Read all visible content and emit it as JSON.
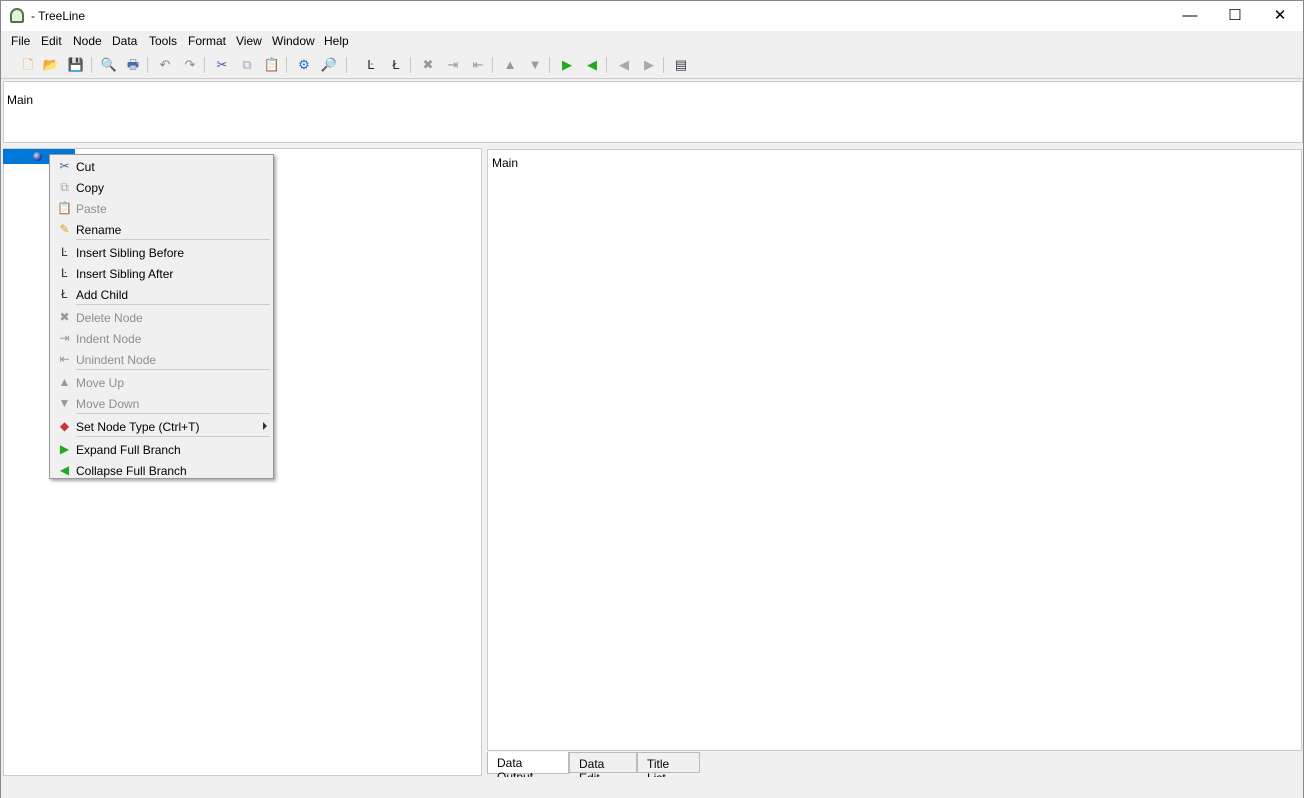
{
  "window": {
    "title": "- TreeLine",
    "minimize": "—",
    "maximize": "☐",
    "close": "✕"
  },
  "menubar": [
    "File",
    "Edit",
    "Node",
    "Data",
    "Tools",
    "Format",
    "View",
    "Window",
    "Help"
  ],
  "toolbar": [
    {
      "name": "new-file",
      "glyph": "🗋",
      "color": "#e8a84a"
    },
    {
      "name": "open-file",
      "glyph": "📂",
      "color": "#3a7bd5"
    },
    {
      "name": "save-file",
      "glyph": "💾",
      "color": "#999"
    },
    {
      "name": "print-preview",
      "glyph": "🔍",
      "color": "#3a6fb0"
    },
    {
      "name": "print",
      "glyph": "🖶",
      "color": "#4a6fa8"
    },
    {
      "name": "undo",
      "glyph": "↶",
      "color": "#888"
    },
    {
      "name": "redo",
      "glyph": "↷",
      "color": "#888"
    },
    {
      "name": "cut",
      "glyph": "✂",
      "color": "#3a5fa0"
    },
    {
      "name": "copy",
      "glyph": "⧉",
      "color": "#9ab"
    },
    {
      "name": "paste",
      "glyph": "📋",
      "color": "#aaa"
    },
    {
      "name": "settings",
      "glyph": "⚙",
      "color": "#1a6fc8"
    },
    {
      "name": "find",
      "glyph": "🔎",
      "color": "#777"
    },
    {
      "name": "insert-sibling",
      "glyph": "Ŀ",
      "color": "#223"
    },
    {
      "name": "add-child",
      "glyph": "Ł",
      "color": "#223"
    },
    {
      "name": "delete-node",
      "glyph": "✖",
      "color": "#999"
    },
    {
      "name": "indent-node",
      "glyph": "⇥",
      "color": "#999"
    },
    {
      "name": "unindent-node",
      "glyph": "⇤",
      "color": "#999"
    },
    {
      "name": "move-up",
      "glyph": "▲",
      "color": "#999"
    },
    {
      "name": "move-down",
      "glyph": "▼",
      "color": "#999"
    },
    {
      "name": "expand-branch",
      "glyph": "▶",
      "color": "#2a2"
    },
    {
      "name": "collapse-branch",
      "glyph": "◀",
      "color": "#2a2"
    },
    {
      "name": "back",
      "glyph": "◀",
      "color": "#aaa"
    },
    {
      "name": "forward",
      "glyph": "▶",
      "color": "#aaa"
    },
    {
      "name": "show-output",
      "glyph": "▤",
      "color": "#334"
    }
  ],
  "top_pane": {
    "text": "Main"
  },
  "right_pane": {
    "text": "Main"
  },
  "tabs": [
    "Data Output",
    "Data Edit",
    "Title List"
  ],
  "context_menu": [
    {
      "label": "Cut",
      "icon": "✂",
      "color": "#3a5fa0",
      "enabled": true
    },
    {
      "label": "Copy",
      "icon": "⧉",
      "color": "#9ab",
      "enabled": true
    },
    {
      "label": "Paste",
      "icon": "📋",
      "color": "#aaa",
      "enabled": false
    },
    {
      "label": "Rename",
      "icon": "✎",
      "color": "#d9a020",
      "enabled": true
    },
    {
      "label": "Insert Sibling Before",
      "icon": "Ŀ",
      "color": "#223",
      "enabled": true
    },
    {
      "label": "Insert Sibling After",
      "icon": "Ŀ",
      "color": "#223",
      "enabled": true
    },
    {
      "label": "Add Child",
      "icon": "Ł",
      "color": "#223",
      "enabled": true
    },
    {
      "label": "Delete Node",
      "icon": "✖",
      "color": "#999",
      "enabled": false
    },
    {
      "label": "Indent Node",
      "icon": "⇥",
      "color": "#999",
      "enabled": false
    },
    {
      "label": "Unindent Node",
      "icon": "⇤",
      "color": "#999",
      "enabled": false
    },
    {
      "label": "Move Up",
      "icon": "▲",
      "color": "#999",
      "enabled": false
    },
    {
      "label": "Move Down",
      "icon": "▼",
      "color": "#999",
      "enabled": false
    },
    {
      "label": "Set Node Type  (Ctrl+T)",
      "icon": "◆",
      "color": "#c33",
      "enabled": true,
      "submenu": true
    },
    {
      "label": "Expand Full Branch",
      "icon": "▶",
      "color": "#2a2",
      "enabled": true
    },
    {
      "label": "Collapse Full Branch",
      "icon": "◀",
      "color": "#2a2",
      "enabled": true
    }
  ]
}
